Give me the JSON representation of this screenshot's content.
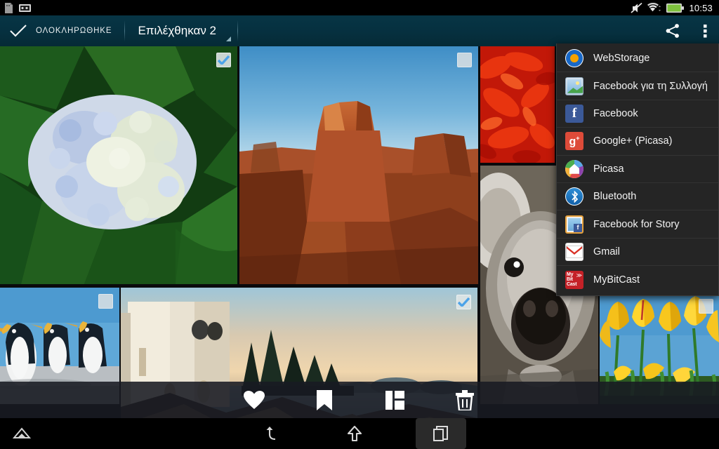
{
  "status_bar": {
    "time": "10:53",
    "left_icons": [
      "document-notification-icon",
      "screenshot-notification-icon"
    ],
    "right_icons": [
      "mute-icon",
      "wifi-icon",
      "battery-icon"
    ],
    "battery_color": "#7ec13d"
  },
  "action_bar": {
    "done_label": "ΟΛΟΚΛΗΡΩΘΗΚΕ",
    "selection_label": "Επιλέχθηκαν 2",
    "share_icon": "share-icon",
    "overflow_icon": "overflow-menu-icon",
    "background_color": "#06303f"
  },
  "share_menu": {
    "items": [
      {
        "label": "WebStorage",
        "icon": "webstorage-icon"
      },
      {
        "label": "Facebook για τη Συλλογή",
        "icon": "facebook-gallery-icon"
      },
      {
        "label": "Facebook",
        "icon": "facebook-icon"
      },
      {
        "label": "Google+ (Picasa)",
        "icon": "google-plus-icon"
      },
      {
        "label": "Picasa",
        "icon": "picasa-icon"
      },
      {
        "label": "Bluetooth",
        "icon": "bluetooth-icon"
      },
      {
        "label": "Facebook for Story",
        "icon": "facebook-story-icon"
      },
      {
        "label": "Gmail",
        "icon": "gmail-icon"
      },
      {
        "label": "MyBitCast",
        "icon": "mybitcast-icon"
      }
    ]
  },
  "grid": {
    "photos": [
      {
        "name": "hydrangea-flowers",
        "selected": true
      },
      {
        "name": "desert-mesa-landscape",
        "selected": false
      },
      {
        "name": "red-dahlia-flower",
        "selected": false
      },
      {
        "name": "koala-bear",
        "selected": false
      },
      {
        "name": "king-penguins",
        "selected": false
      },
      {
        "name": "lighthouse-coast",
        "selected": true
      },
      {
        "name": "yellow-tulips",
        "selected": false
      }
    ],
    "selected_count": 2
  },
  "bottom_toolbar": {
    "buttons": [
      {
        "name": "favorite-button",
        "icon": "heart-icon"
      },
      {
        "name": "bookmark-button",
        "icon": "bookmark-icon"
      },
      {
        "name": "collage-button",
        "icon": "collage-icon"
      },
      {
        "name": "delete-button",
        "icon": "trash-icon"
      }
    ]
  },
  "nav_bar": {
    "buttons": [
      {
        "name": "expand-button",
        "icon": "triangle-up-icon"
      },
      {
        "name": "back-button",
        "icon": "back-arrow-icon"
      },
      {
        "name": "home-button",
        "icon": "home-arrow-icon"
      },
      {
        "name": "recents-button",
        "icon": "recent-apps-icon",
        "active": true
      }
    ]
  }
}
